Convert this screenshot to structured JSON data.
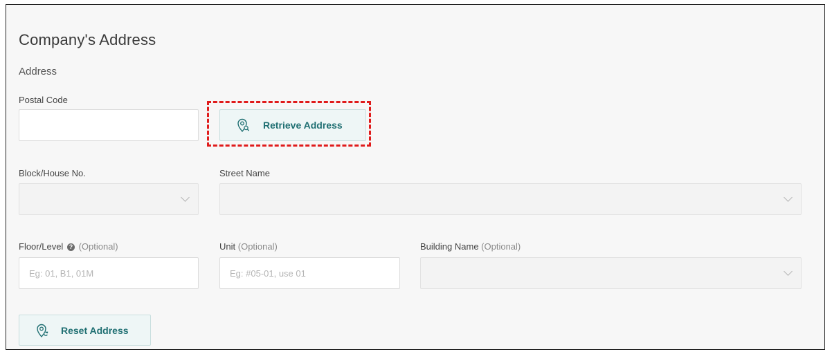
{
  "page_title": "Company's Address",
  "section_title": "Address",
  "postal_code": {
    "label": "Postal Code",
    "value": ""
  },
  "retrieve_button": {
    "label": "Retrieve Address",
    "icon": "map-pin-search-icon"
  },
  "block": {
    "label": "Block/House No.",
    "value": ""
  },
  "street": {
    "label": "Street Name",
    "value": ""
  },
  "floor": {
    "label": "Floor/Level",
    "optional": "(Optional)",
    "placeholder": "Eg: 01, B1, 01M",
    "help_icon": "?"
  },
  "unit": {
    "label": "Unit",
    "optional": "(Optional)",
    "placeholder": "Eg: #05-01, use 01"
  },
  "building": {
    "label": "Building Name",
    "optional": "(Optional)",
    "value": ""
  },
  "reset_button": {
    "label": "Reset Address",
    "icon": "map-pin-reset-icon"
  },
  "colors": {
    "accent": "#1f6f72",
    "highlight": "#e01b1b",
    "button_bg": "#eef6f6"
  }
}
